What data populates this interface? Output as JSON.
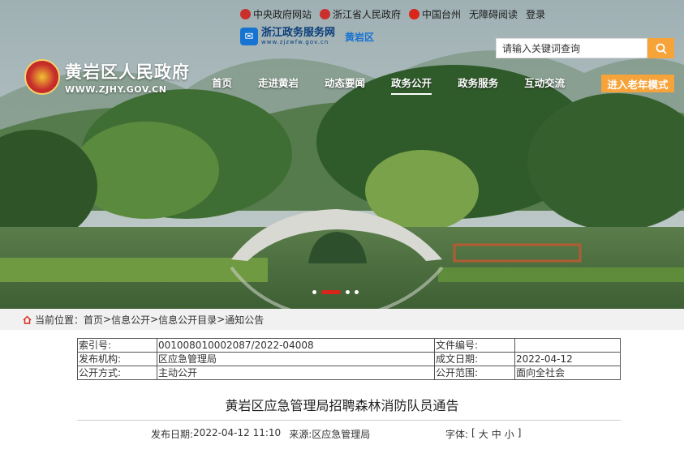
{
  "top_links": [
    {
      "label": "中央政府网站",
      "icon": "national-emblem-icon",
      "color": "#c9302c"
    },
    {
      "label": "浙江省人民政府",
      "icon": "zhejiang-emblem-icon",
      "color": "#c9302c"
    },
    {
      "label": "中国台州",
      "icon": "taizhou-emblem-icon",
      "color": "#d8261a"
    },
    {
      "label": "无障碍阅读"
    },
    {
      "label": "登录"
    }
  ],
  "zj_service": {
    "name": "浙江政务服务网",
    "url": "www.zjzwfw.gov.cn",
    "district": "黄岩区"
  },
  "search": {
    "placeholder": "请输入关键词查询"
  },
  "brand": {
    "title": "黄岩区人民政府",
    "url": "WWW.ZJHY.GOV.CN"
  },
  "nav": [
    "首页",
    "走进黄岩",
    "动态要闻",
    "政务公开",
    "政务服务",
    "互动交流"
  ],
  "nav_active": "政务公开",
  "elder_mode": "进入老年模式",
  "breadcrumb": {
    "prefix": "当前位置：",
    "items": [
      "首页",
      "信息公开",
      "信息公开目录",
      "通知公告"
    ],
    "sep": " > "
  },
  "info_table": [
    [
      "索引号:",
      "001008010002087/2022-04008",
      "文件编号:",
      ""
    ],
    [
      "发布机构:",
      "区应急管理局",
      "成文日期:",
      "2022-04-12"
    ],
    [
      "公开方式:",
      "主动公开",
      "公开范围:",
      "面向全社会"
    ]
  ],
  "article": {
    "title": "黄岩区应急管理局招聘森林消防队员通告",
    "publish_label": "发布日期: ",
    "publish_date": "2022-04-12 11:10",
    "source_label": "来源: ",
    "source": "区应急管理局",
    "font_label": "字体: ",
    "font_sizes": [
      "[",
      "大",
      "中",
      "小",
      "]"
    ]
  },
  "colors": {
    "accent": "#f6a33a",
    "active_dot": "#d8261a",
    "brand_blue": "#1673d1"
  }
}
